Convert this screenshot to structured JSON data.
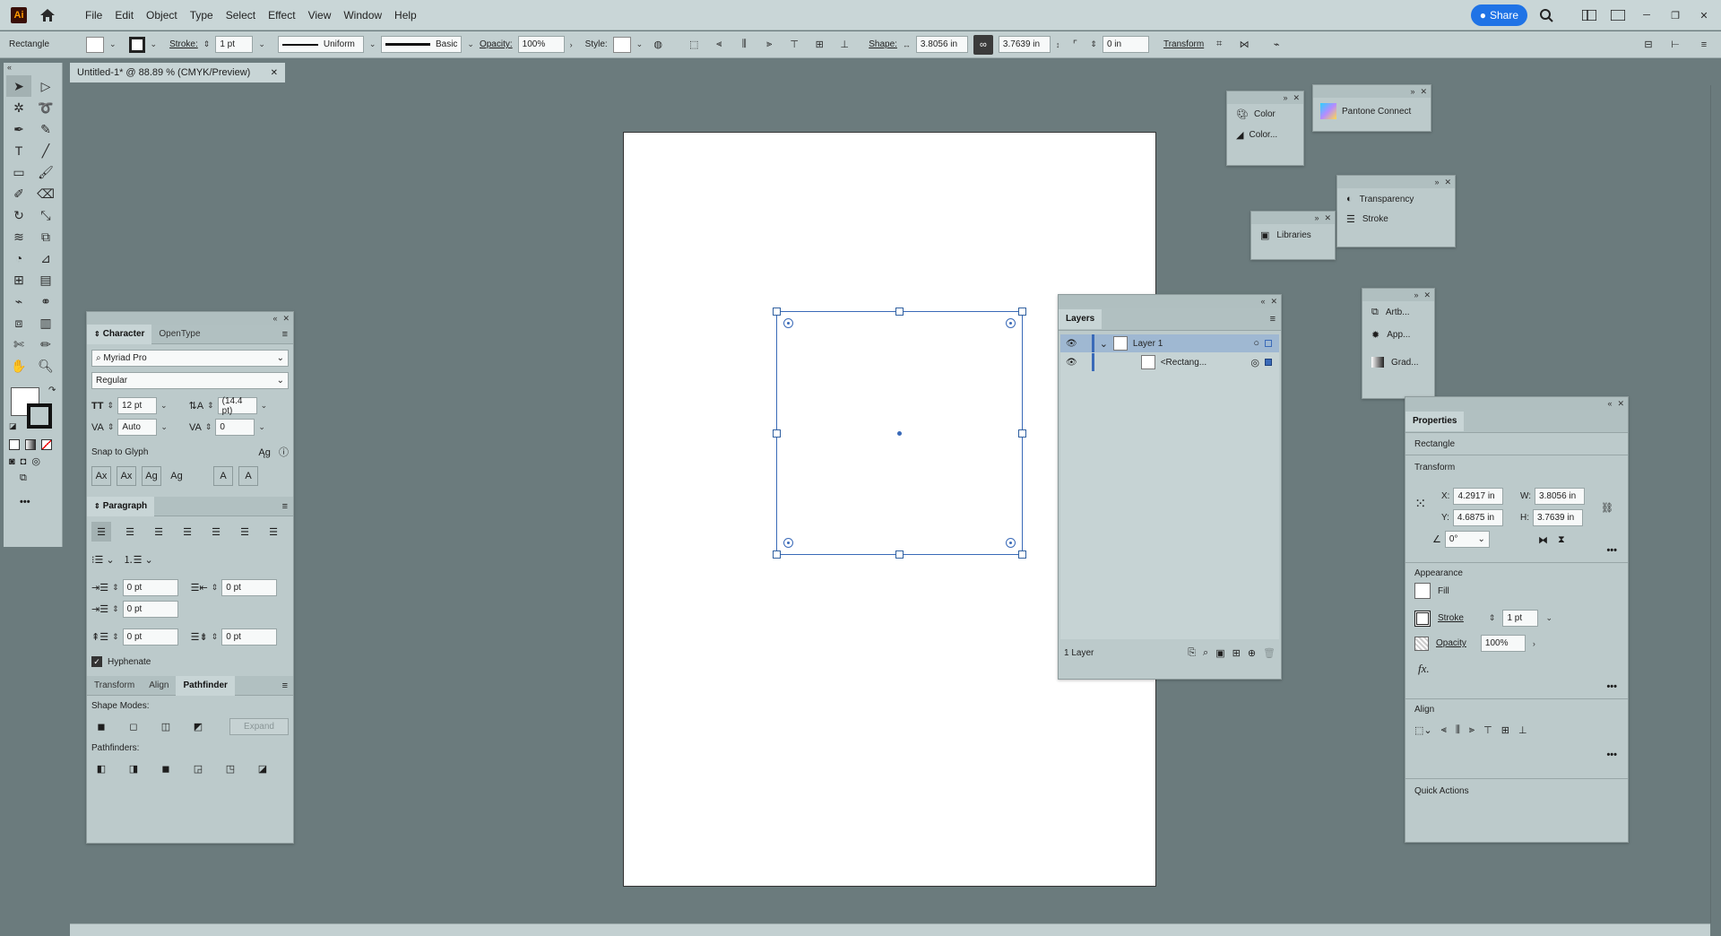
{
  "menubar": {
    "app_logo": "Ai",
    "items": [
      "File",
      "Edit",
      "Object",
      "Type",
      "Select",
      "Effect",
      "View",
      "Window",
      "Help"
    ],
    "share_label": "Share"
  },
  "control": {
    "selection_type": "Rectangle",
    "stroke_label": "Stroke:",
    "stroke_weight": "1 pt",
    "profile": "Uniform",
    "brush": "Basic",
    "opacity_label": "Opacity:",
    "opacity_value": "100%",
    "style_label": "Style:",
    "shape_label": "Shape:",
    "shape_w": "3.8056 in",
    "shape_h": "3.7639 in",
    "corner": "0 in",
    "transform_label": "Transform"
  },
  "document": {
    "tab_title": "Untitled-1* @ 88.89 % (CMYK/Preview)"
  },
  "character": {
    "tabs": [
      "Character",
      "OpenType"
    ],
    "font_family": "Myriad Pro",
    "font_style": "Regular",
    "font_size": "12 pt",
    "leading": "(14.4 pt)",
    "kerning": "Auto",
    "tracking": "0",
    "snap_label": "Snap to Glyph"
  },
  "paragraph": {
    "title": "Paragraph",
    "indent_left": "0 pt",
    "indent_right": "0 pt",
    "indent_first": "0 pt",
    "space_before": "0 pt",
    "space_after": "0 pt",
    "hyphenate_label": "Hyphenate"
  },
  "pathfinder": {
    "tabs": [
      "Transform",
      "Align",
      "Pathfinder"
    ],
    "shape_modes_label": "Shape Modes:",
    "expand_label": "Expand",
    "pathfinders_label": "Pathfinders:"
  },
  "layers": {
    "title": "Layers",
    "rows": [
      {
        "name": "Layer 1"
      },
      {
        "name": "<Rectang..."
      }
    ],
    "footer_count": "1 Layer"
  },
  "mini_panels": {
    "color": "Color",
    "color_guide": "Color...",
    "pantone": "Pantone Connect",
    "transparency": "Transparency",
    "stroke": "Stroke",
    "libraries": "Libraries",
    "artboards": "Artb...",
    "appearance": "App...",
    "gradient": "Grad..."
  },
  "properties": {
    "title": "Properties",
    "object": "Rectangle",
    "transform_label": "Transform",
    "x_label": "X:",
    "x": "4.2917 in",
    "y_label": "Y:",
    "y": "4.6875 in",
    "w_label": "W:",
    "w": "3.8056 in",
    "h_label": "H:",
    "h": "3.7639 in",
    "angle": "0°",
    "appearance_label": "Appearance",
    "fill_label": "Fill",
    "stroke_label": "Stroke",
    "stroke_value": "1 pt",
    "opacity_label": "Opacity",
    "opacity_value": "100%",
    "fx_label": "fx.",
    "align_label": "Align",
    "quick_actions_label": "Quick Actions"
  },
  "colors": {
    "workspace": "#6b7b7d",
    "panel": "#bccacb",
    "selection": "#3a6ab8",
    "share": "#1f73e6"
  }
}
